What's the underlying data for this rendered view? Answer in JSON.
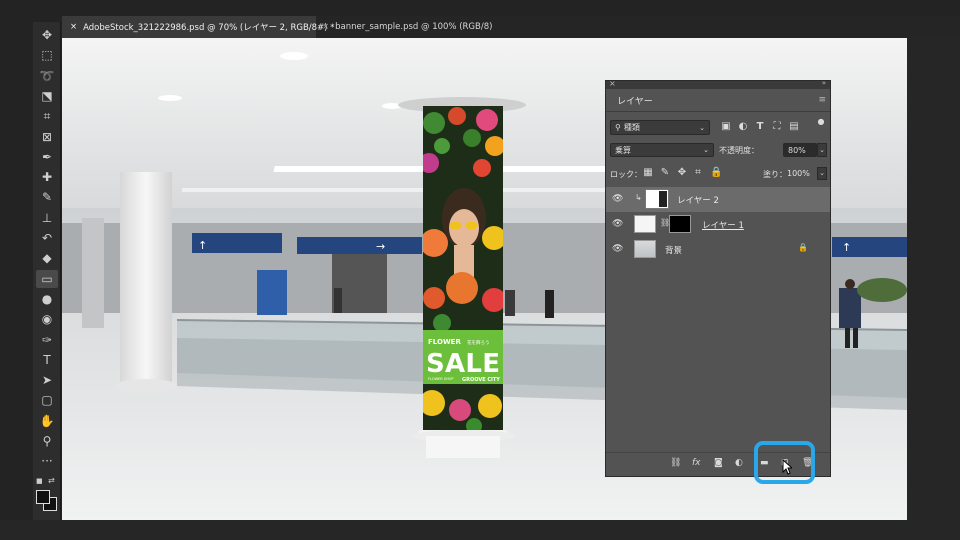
{
  "tabs": [
    {
      "label": "AdobeStock_321222986.psd @ 70% (レイヤー 2, RGB/8#) *"
    },
    {
      "label": "banner_sample.psd @ 100% (RGB/8)"
    }
  ],
  "tab_close": "×",
  "toolbar": {
    "tools": [
      {
        "name": "move-tool",
        "glyph": "✥"
      },
      {
        "name": "marquee-tool",
        "glyph": "⬚"
      },
      {
        "name": "lasso-tool",
        "glyph": "➰"
      },
      {
        "name": "object-select-tool",
        "glyph": "⬔"
      },
      {
        "name": "crop-tool",
        "glyph": "⌗"
      },
      {
        "name": "frame-tool",
        "glyph": "⊠"
      },
      {
        "name": "eyedropper-tool",
        "glyph": "✒"
      },
      {
        "name": "healing-tool",
        "glyph": "✚"
      },
      {
        "name": "brush-tool",
        "glyph": "✎"
      },
      {
        "name": "stamp-tool",
        "glyph": "⊥"
      },
      {
        "name": "history-brush-tool",
        "glyph": "↶"
      },
      {
        "name": "eraser-tool",
        "glyph": "◆"
      },
      {
        "name": "gradient-tool",
        "glyph": "▭"
      },
      {
        "name": "blur-tool",
        "glyph": "●"
      },
      {
        "name": "dodge-tool",
        "glyph": "◉"
      },
      {
        "name": "pen-tool",
        "glyph": "✑"
      },
      {
        "name": "type-tool",
        "glyph": "T"
      },
      {
        "name": "path-select-tool",
        "glyph": "➤"
      },
      {
        "name": "shape-tool",
        "glyph": "▢"
      },
      {
        "name": "hand-tool",
        "glyph": "✋"
      },
      {
        "name": "zoom-tool",
        "glyph": "⚲"
      },
      {
        "name": "more-tools",
        "glyph": "···"
      }
    ]
  },
  "poster": {
    "line1": "FLOWER",
    "line1_jp": "花を飾ろう",
    "line2": "SALE",
    "line3_left": "FLOWER SHOP",
    "line3_right": "GROOVE CITY"
  },
  "layers_panel": {
    "tab_label": "レイヤー",
    "kind_select": "種類",
    "blend_mode": "乗算",
    "opacity_label": "不透明度：",
    "opacity_value": "80%",
    "lock_label": "ロック：",
    "fill_label": "塗り：",
    "fill_value": "100%",
    "layers": [
      {
        "name": "レイヤー 2",
        "selected": true
      },
      {
        "name": "レイヤー 1",
        "selected": false
      },
      {
        "name": "背景",
        "selected": false
      }
    ]
  },
  "colors": {
    "highlight": "#2aa7e8",
    "sale_green": "#6cbf3a"
  }
}
